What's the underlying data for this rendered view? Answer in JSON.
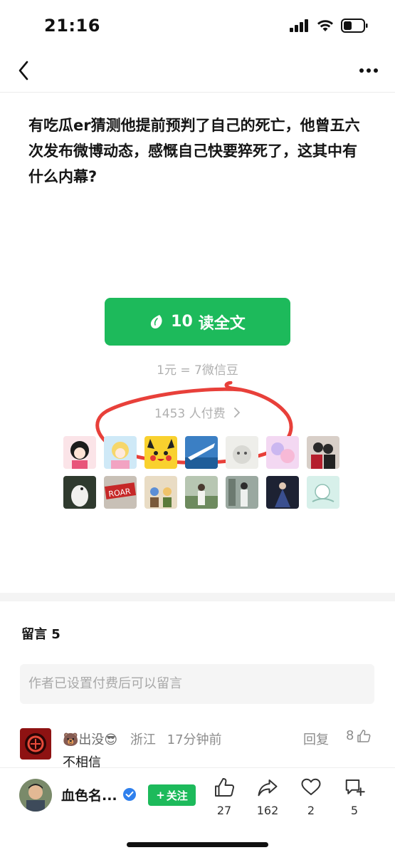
{
  "status_bar": {
    "time": "21:16"
  },
  "article": {
    "title": "有吃瓜er猜测他提前预判了自己的死亡，他曾五六次发布微博动态，感慨自己快要猝死了，这其中有什么内幕?"
  },
  "paywall": {
    "button_amount": "10",
    "button_label": "读全文",
    "rate_text": "1元 = 7微信豆",
    "payers_text": "1453 人付费",
    "accent_color": "#1dba5b",
    "annotation_color": "#e8403a"
  },
  "payer_avatars": [
    "avatar-anime-girl",
    "avatar-cartoon-girl",
    "avatar-pikachu",
    "avatar-airplane",
    "avatar-white-cat",
    "avatar-pastel",
    "avatar-couple",
    "avatar-bird",
    "avatar-roar",
    "avatar-cartoon-kids",
    "avatar-woman-field",
    "avatar-woman-traditional",
    "avatar-night-dress",
    "avatar-sketch"
  ],
  "comments": {
    "header": "留言 5",
    "input_placeholder": "作者已设置付费后可以留言",
    "items": [
      {
        "nickname": "🐻出没😎",
        "location": "浙江",
        "time": "17分钟前",
        "reply_label": "回复",
        "likes": "8",
        "text": "不相信"
      }
    ]
  },
  "bottom_bar": {
    "author_name": "血色名...",
    "follow_label": "关注",
    "likes": "27",
    "shares": "162",
    "favorites": "2",
    "comments": "5"
  }
}
